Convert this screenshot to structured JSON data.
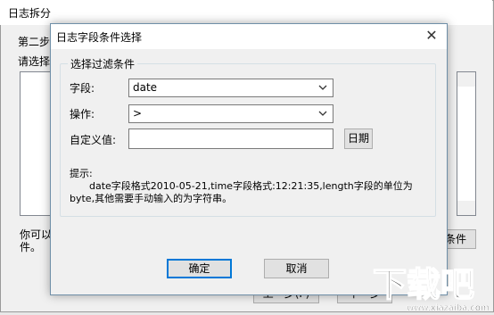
{
  "background_window": {
    "title": "日志拆分",
    "step_label": "第二步",
    "prompt_label": "请选择",
    "note_line1": "你可以",
    "note_line2": "件。",
    "condition_button": "条件",
    "prev_button": "上一步(P)",
    "next_button": "下一步"
  },
  "dialog": {
    "title": "日志字段条件选择",
    "group_title": "选择过滤条件",
    "field_label": "字段:",
    "field_value": "date",
    "operation_label": "操作:",
    "operation_value": ">",
    "custom_label": "自定义值:",
    "custom_value": "",
    "date_button": "日期",
    "tip_label": "提示:",
    "tip_line1": "date字段格式2010-05-21,time字段格式:12:21:35,length字段的单位为",
    "tip_line2": "byte,其他需要手动输入的为字符串。",
    "ok_button": "确定",
    "cancel_button": "取消"
  },
  "watermark": {
    "cn": "下载吧",
    "url": "www.xiazaiba.com"
  }
}
